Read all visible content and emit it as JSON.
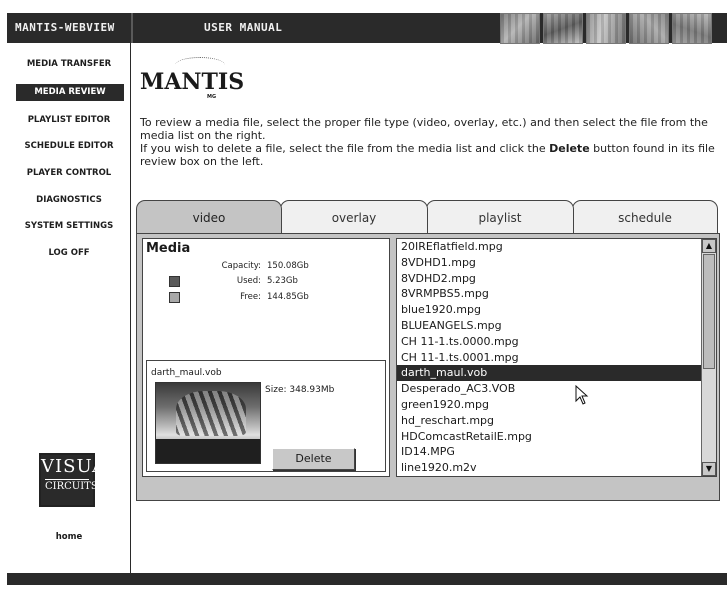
{
  "topbar": {
    "app_title": "MANTIS-WEBVIEW",
    "manual_label": "USER MANUAL",
    "thumbnails": [
      "thumbnail-1",
      "thumbnail-2",
      "thumbnail-3",
      "thumbnail-4",
      "thumbnail-5"
    ]
  },
  "sidebar": {
    "items": [
      {
        "label": "MEDIA TRANSFER"
      },
      {
        "label": "MEDIA REVIEW",
        "active": true
      },
      {
        "label": "PLAYLIST EDITOR"
      },
      {
        "label": "SCHEDULE EDITOR"
      },
      {
        "label": "PLAYER CONTROL"
      },
      {
        "label": "DIAGNOSTICS"
      },
      {
        "label": "SYSTEM SETTINGS"
      },
      {
        "label": "LOG OFF"
      }
    ],
    "logo_line1": "VISUAL",
    "logo_line2": "CIRCUITS",
    "home_label": "home"
  },
  "brand": {
    "name": "MANTIS",
    "sub": "MG"
  },
  "instructions": {
    "line1": "To review a media file, select the proper file type (video, overlay, etc.) and then select the file from the media list on the right.",
    "line2_pre": "If you wish to delete a file, select the file from the media list and click the ",
    "line2_bold": "Delete",
    "line2_post": " button found in its file review box on the left."
  },
  "tabs": [
    {
      "label": "video",
      "active": true
    },
    {
      "label": "overlay"
    },
    {
      "label": "playlist"
    },
    {
      "label": "schedule"
    }
  ],
  "media": {
    "title": "Media",
    "capacity_label": "Capacity:",
    "capacity_value": "150.08Gb",
    "used_label": "Used:",
    "used_value": "5.23Gb",
    "free_label": "Free:",
    "free_value": "144.85Gb",
    "used_color": "#5a5a5a",
    "free_color": "#a8a8a8"
  },
  "file_review": {
    "filename": "darth_maul.vob",
    "size": "Size: 348.93Mb",
    "delete_label": "Delete"
  },
  "media_list": {
    "items": [
      "20IREflatfield.mpg",
      "8VDHD1.mpg",
      "8VDHD2.mpg",
      "8VRMPBS5.mpg",
      "blue1920.mpg",
      "BLUEANGELS.mpg",
      "CH 11-1.ts.0000.mpg",
      "CH 11-1.ts.0001.mpg",
      "darth_maul.vob",
      "Desperado_AC3.VOB",
      "green1920.mpg",
      "hd_reschart.mpg",
      "HDComcastRetailE.mpg",
      "ID14.MPG",
      "line1920.m2v"
    ],
    "selected": "darth_maul.vob"
  }
}
